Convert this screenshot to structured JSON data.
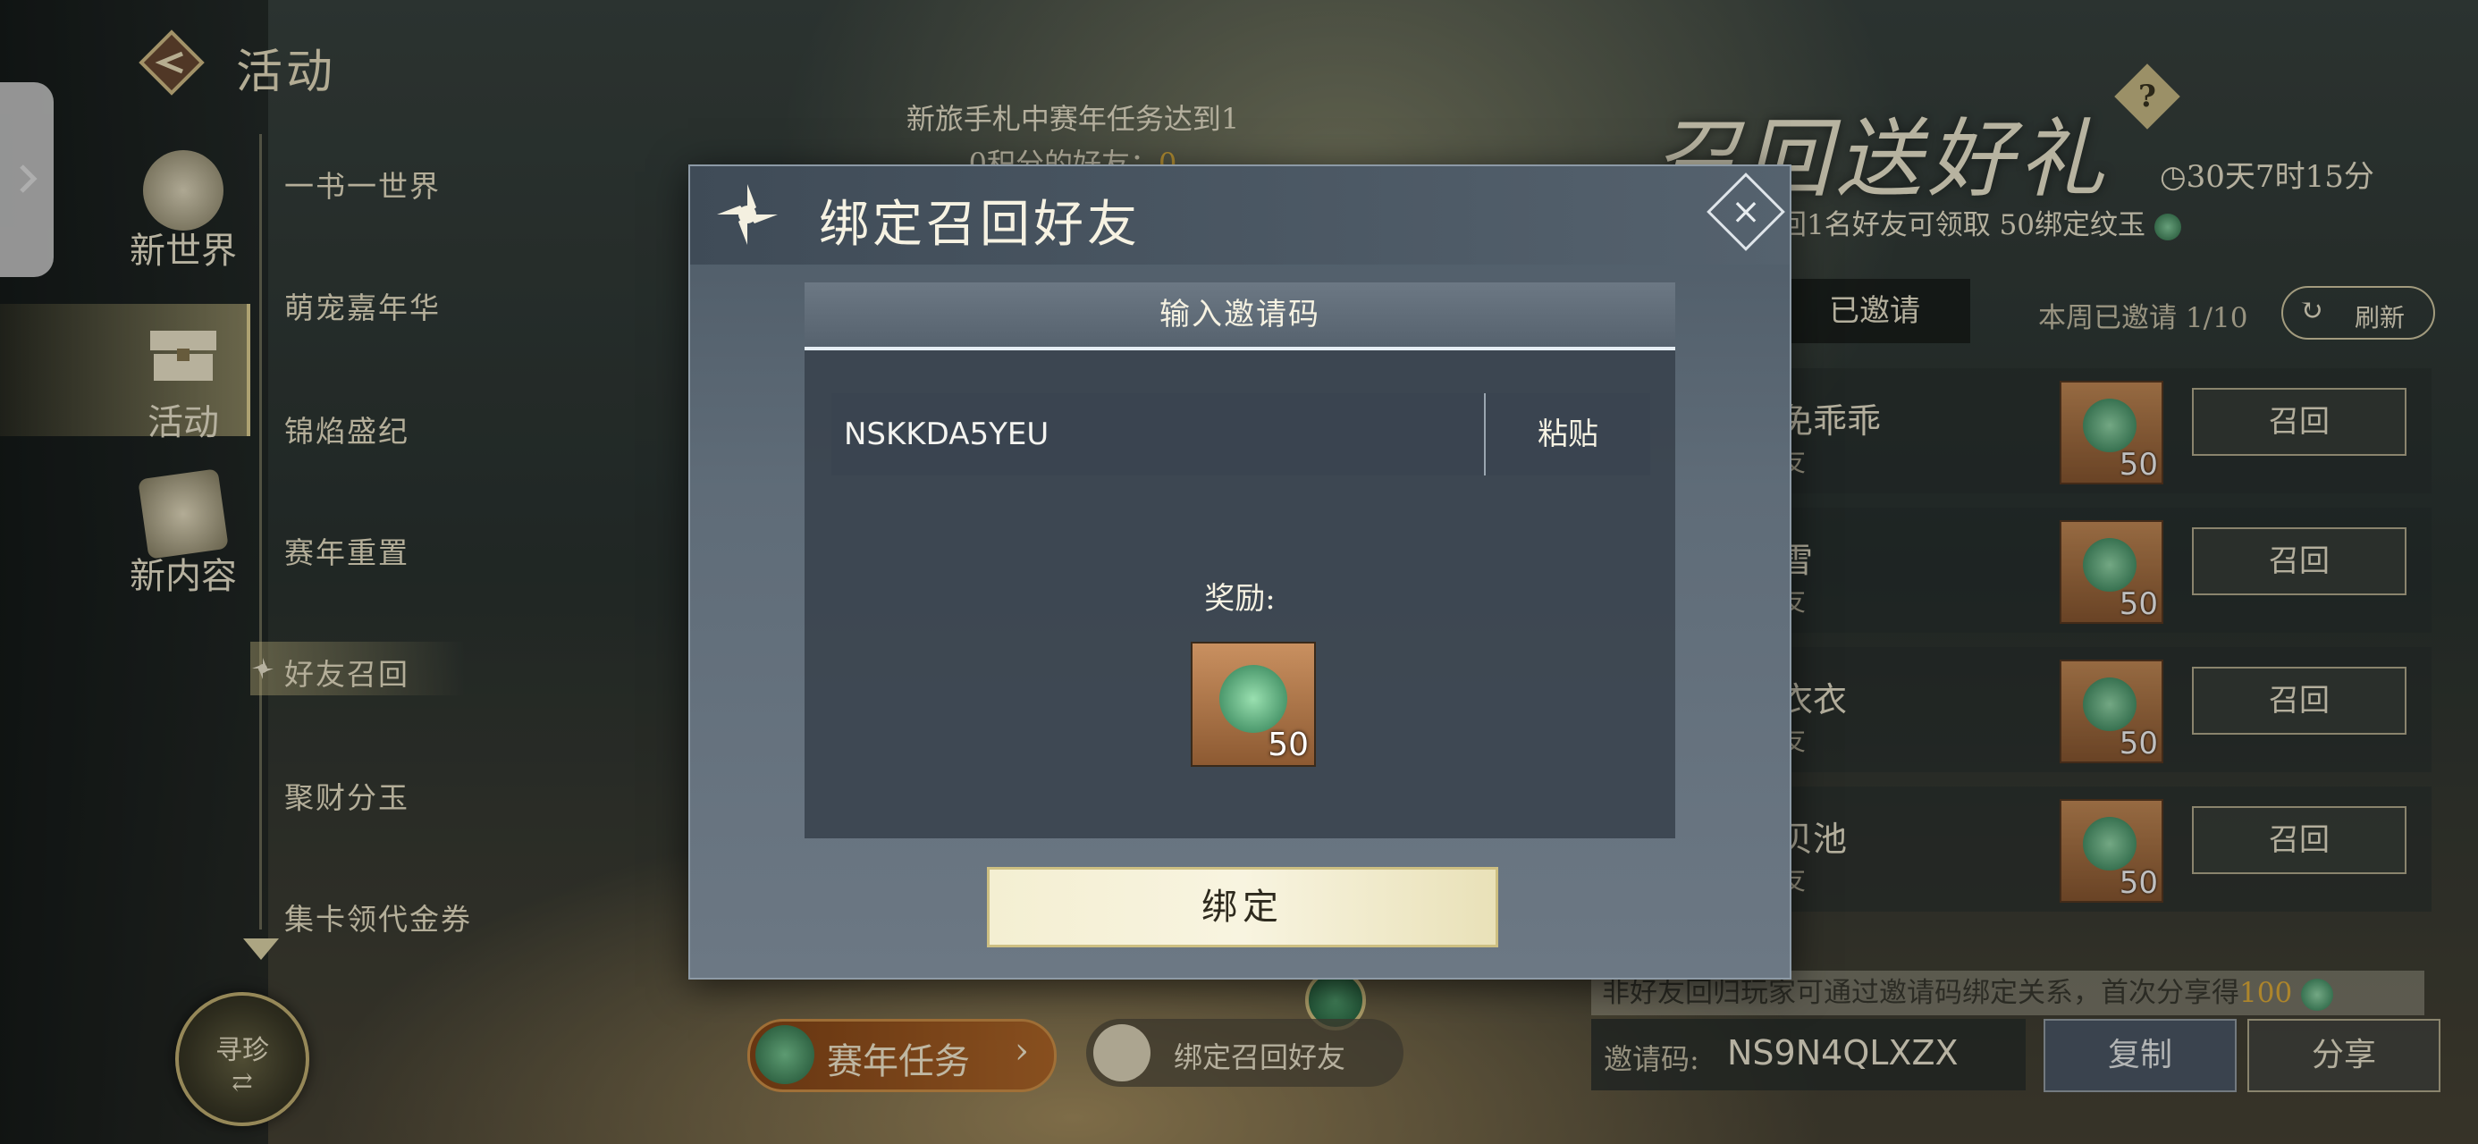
{
  "sidebar": {
    "title": "活动",
    "categories": [
      {
        "label": "新世界"
      },
      {
        "label": "活动"
      },
      {
        "label": "新内容"
      }
    ],
    "sub_items": [
      {
        "label": "一书一世界"
      },
      {
        "label": "萌宠嘉年华"
      },
      {
        "label": "锦焰盛纪"
      },
      {
        "label": "赛年重置"
      },
      {
        "label": "好友召回"
      },
      {
        "label": "聚财分玉"
      },
      {
        "label": "集卡领代金券"
      }
    ],
    "treasure_button": "寻珍"
  },
  "background": {
    "task_text_line1": "新旅手札中赛年任务达到1",
    "task_text_line2": "0积分的好友：",
    "task_text_value": "0",
    "task_button": "赛年任务",
    "bind_recall_button": "绑定召回好友"
  },
  "recall_panel": {
    "title": "召回送好礼",
    "timer": "30天7时15分",
    "desc": "回1名好友可领取 50绑定纹玉",
    "tab_invited": "已邀请",
    "week_count": "本周已邀请 1/10",
    "refresh": "刷新",
    "friends": [
      {
        "name": "免乖乖",
        "sub": "友",
        "reward": "50",
        "button": "召回"
      },
      {
        "name": "雪",
        "sub": "友",
        "reward": "50",
        "button": "召回"
      },
      {
        "name": "衣衣",
        "sub": "友",
        "reward": "50",
        "button": "召回"
      },
      {
        "name": "贝池",
        "sub": "友",
        "reward": "50",
        "button": "召回"
      }
    ],
    "share_note": "非好友回归玩家可通过邀请码绑定关系，首次分享得",
    "share_note_value": "100",
    "invite_code_label": "邀请码:",
    "invite_code": "NS9N4QLXZX",
    "copy": "复制",
    "share": "分享"
  },
  "modal": {
    "title": "绑定召回好友",
    "section_header": "输入邀请码",
    "code_value": "NSKKDA5YEU",
    "paste": "粘贴",
    "reward_label": "奖励:",
    "reward_count": "50",
    "bind_button": "绑定"
  }
}
